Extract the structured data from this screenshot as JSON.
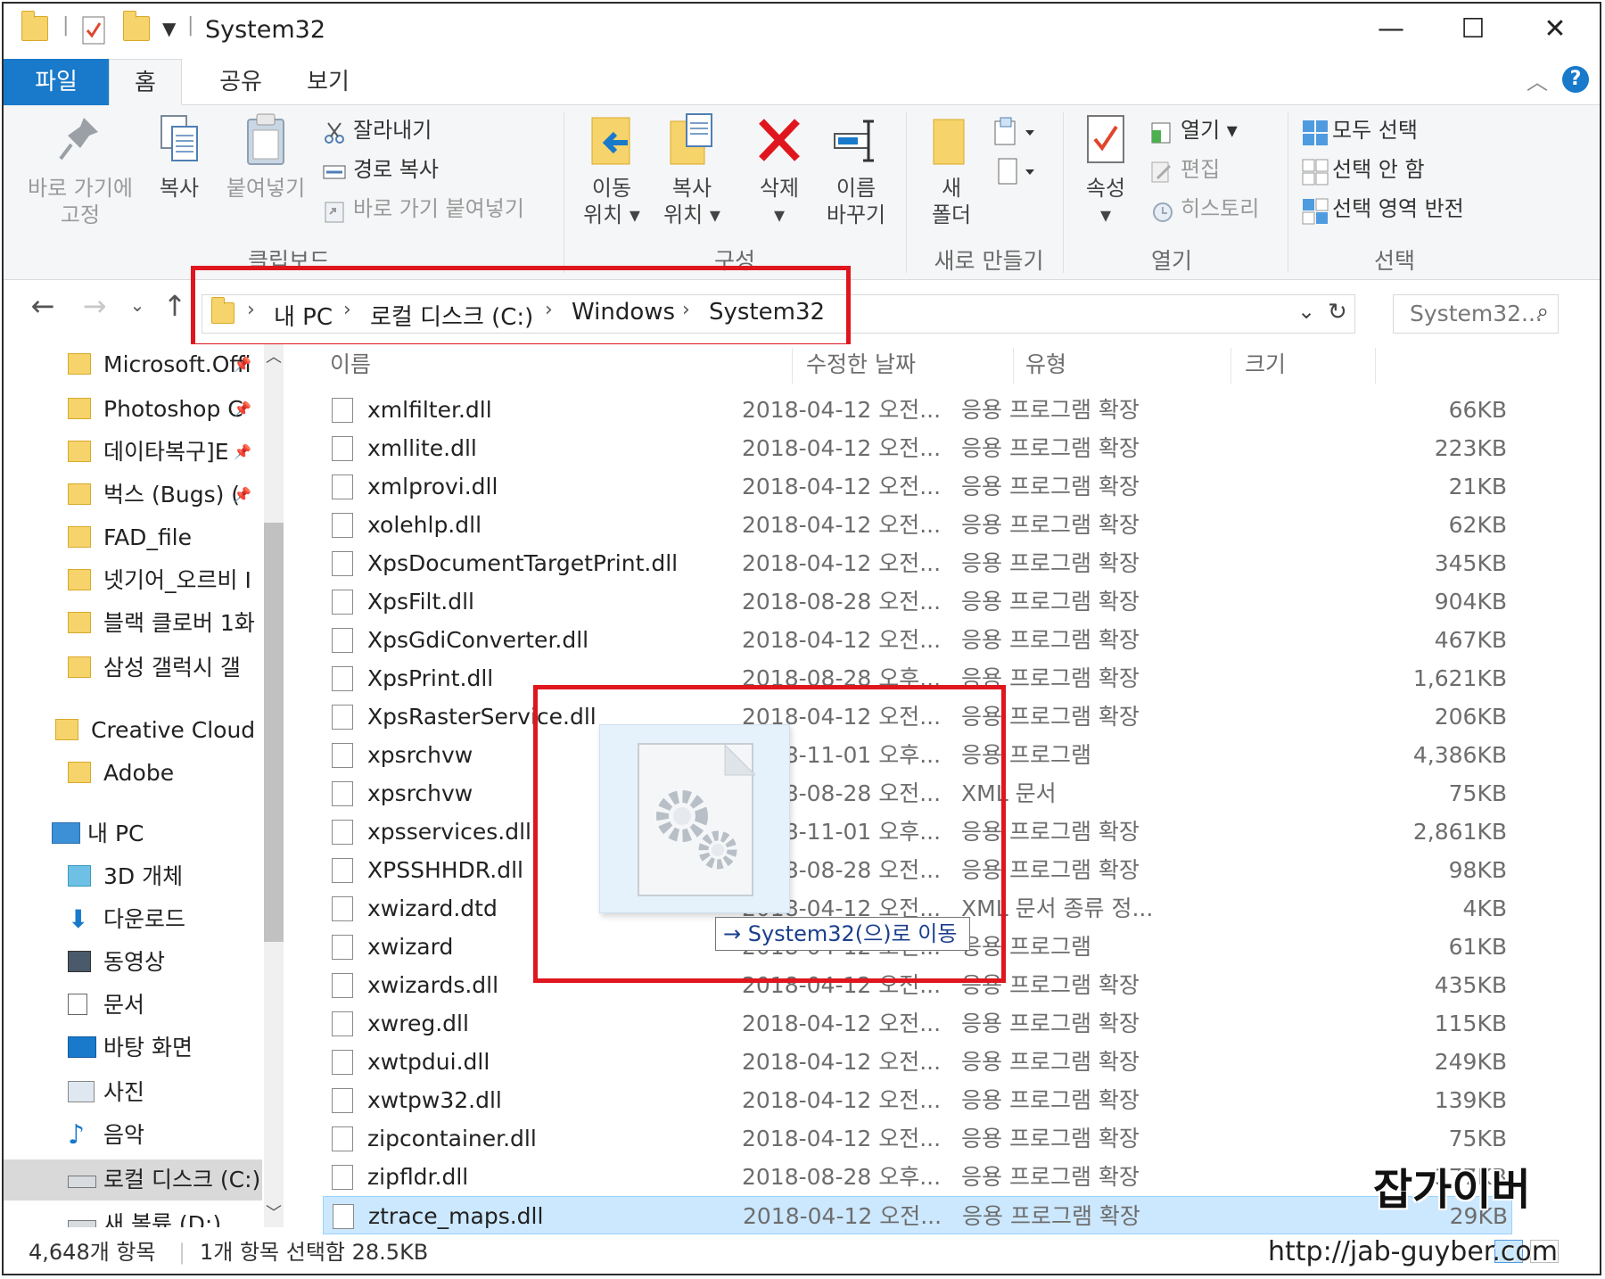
{
  "window": {
    "title": "System32",
    "minimize": "—",
    "maximize": "☐",
    "close": "✕"
  },
  "ribbon_tabs": [
    "파일",
    "홈",
    "공유",
    "보기"
  ],
  "ribbon": {
    "clipboard": {
      "label": "클립보드",
      "pin": "바로 가기에\n고정",
      "copy": "복사",
      "paste": "붙여넣기",
      "cut": "잘라내기",
      "copy_path": "경로 복사",
      "paste_shortcut": "바로 가기 붙여넣기"
    },
    "organize": {
      "label": "구성",
      "move_to": "이동\n위치 ▾",
      "copy_to": "복사\n위치 ▾",
      "delete": "삭제\n▾",
      "rename": "이름\n바꾸기"
    },
    "new": {
      "label": "새로 만들기",
      "new_folder": "새\n폴더"
    },
    "open": {
      "label": "열기",
      "properties": "속성\n▾",
      "open": "열기 ▾",
      "edit": "편집",
      "history": "히스토리"
    },
    "select": {
      "label": "선택",
      "select_all": "모두 선택",
      "select_none": "선택 안 함",
      "invert": "선택 영역 반전"
    }
  },
  "address": {
    "crumbs": [
      "내 PC",
      "로컬 디스크 (C:)",
      "Windows",
      "System32"
    ],
    "search_placeholder": "System32..."
  },
  "nav_pane": [
    {
      "label": "Microsoft.Offi",
      "pinned": true
    },
    {
      "label": "Photoshop C",
      "pinned": true
    },
    {
      "label": "데이타복구]E",
      "pinned": true
    },
    {
      "label": "벅스 (Bugs) (",
      "pinned": true
    },
    {
      "label": "FAD_file",
      "pinned": false
    },
    {
      "label": "넷기어_오르비 I",
      "pinned": false
    },
    {
      "label": "블랙 클로버 1화",
      "pinned": false
    },
    {
      "label": "삼성 갤럭시 갤",
      "pinned": false
    },
    {
      "label": "Creative Cloud Fil",
      "pinned": false
    },
    {
      "label": "Adobe",
      "pinned": false
    },
    {
      "label": "내 PC",
      "pinned": false
    },
    {
      "label": "3D 개체",
      "pinned": false
    },
    {
      "label": "다운로드",
      "pinned": false
    },
    {
      "label": "동영상",
      "pinned": false
    },
    {
      "label": "문서",
      "pinned": false
    },
    {
      "label": "바탕 화면",
      "pinned": false
    },
    {
      "label": "사진",
      "pinned": false
    },
    {
      "label": "음악",
      "pinned": false
    },
    {
      "label": "로컬 디스크 (C:)",
      "pinned": false
    },
    {
      "label": "새 볼륨 (D:)",
      "pinned": false
    }
  ],
  "columns": [
    "이름",
    "수정한 날짜",
    "유형",
    "크기"
  ],
  "files": [
    {
      "name": "xmlfilter.dll",
      "date": "2018-04-12 오전...",
      "type": "응용 프로그램 확장",
      "size": "66KB"
    },
    {
      "name": "xmllite.dll",
      "date": "2018-04-12 오전...",
      "type": "응용 프로그램 확장",
      "size": "223KB"
    },
    {
      "name": "xmlprovi.dll",
      "date": "2018-04-12 오전...",
      "type": "응용 프로그램 확장",
      "size": "21KB"
    },
    {
      "name": "xolehlp.dll",
      "date": "2018-04-12 오전...",
      "type": "응용 프로그램 확장",
      "size": "62KB"
    },
    {
      "name": "XpsDocumentTargetPrint.dll",
      "date": "2018-04-12 오전...",
      "type": "응용 프로그램 확장",
      "size": "345KB"
    },
    {
      "name": "XpsFilt.dll",
      "date": "2018-08-28 오전...",
      "type": "응용 프로그램 확장",
      "size": "904KB"
    },
    {
      "name": "XpsGdiConverter.dll",
      "date": "2018-04-12 오전...",
      "type": "응용 프로그램 확장",
      "size": "467KB"
    },
    {
      "name": "XpsPrint.dll",
      "date": "2018-08-28 오후...",
      "type": "응용 프로그램 확장",
      "size": "1,621KB"
    },
    {
      "name": "XpsRasterService.dll",
      "date": "2018-04-12 오전...",
      "type": "응용 프로그램 확장",
      "size": "206KB"
    },
    {
      "name": "xpsrchvw",
      "date": "2018-11-01 오후...",
      "type": "응용 프로그램",
      "size": "4,386KB"
    },
    {
      "name": "xpsrchvw",
      "date": "2018-08-28 오전...",
      "type": "XML 문서",
      "size": "75KB"
    },
    {
      "name": "xpsservices.dll",
      "date": "2018-11-01 오후...",
      "type": "응용 프로그램 확장",
      "size": "2,861KB"
    },
    {
      "name": "XPSSHHDR.dll",
      "date": "2018-08-28 오전...",
      "type": "응용 프로그램 확장",
      "size": "98KB"
    },
    {
      "name": "xwizard.dtd",
      "date": "2018-04-12 오전...",
      "type": "XML 문서 종류 정...",
      "size": "4KB"
    },
    {
      "name": "xwizard",
      "date": "2018-04-12 오전...",
      "type": "응용 프로그램",
      "size": "61KB"
    },
    {
      "name": "xwizards.dll",
      "date": "2018-04-12 오전...",
      "type": "응용 프로그램 확장",
      "size": "435KB"
    },
    {
      "name": "xwreg.dll",
      "date": "2018-04-12 오전...",
      "type": "응용 프로그램 확장",
      "size": "115KB"
    },
    {
      "name": "xwtpdui.dll",
      "date": "2018-04-12 오전...",
      "type": "응용 프로그램 확장",
      "size": "249KB"
    },
    {
      "name": "xwtpw32.dll",
      "date": "2018-04-12 오전...",
      "type": "응용 프로그램 확장",
      "size": "139KB"
    },
    {
      "name": "zipcontainer.dll",
      "date": "2018-04-12 오전...",
      "type": "응용 프로그램 확장",
      "size": "75KB"
    },
    {
      "name": "zipfldr.dll",
      "date": "2018-08-28 오후...",
      "type": "응용 프로그램 확장",
      "size": "377KB"
    },
    {
      "name": "ztrace_maps.dll",
      "date": "2018-04-12 오전...",
      "type": "응용 프로그램 확장",
      "size": "29KB",
      "selected": true
    }
  ],
  "drag": {
    "tooltip": "→ System32(으)로 이동"
  },
  "status": {
    "count": "4,648개 항목",
    "selection": "1개 항목 선택함 28.5KB"
  },
  "watermark": {
    "brand": "잡가이버",
    "url": "http://jab-guyber.com"
  },
  "colors": {
    "accent": "#1979ca",
    "highlight": "#e0161e",
    "selection": "#cce8ff"
  }
}
